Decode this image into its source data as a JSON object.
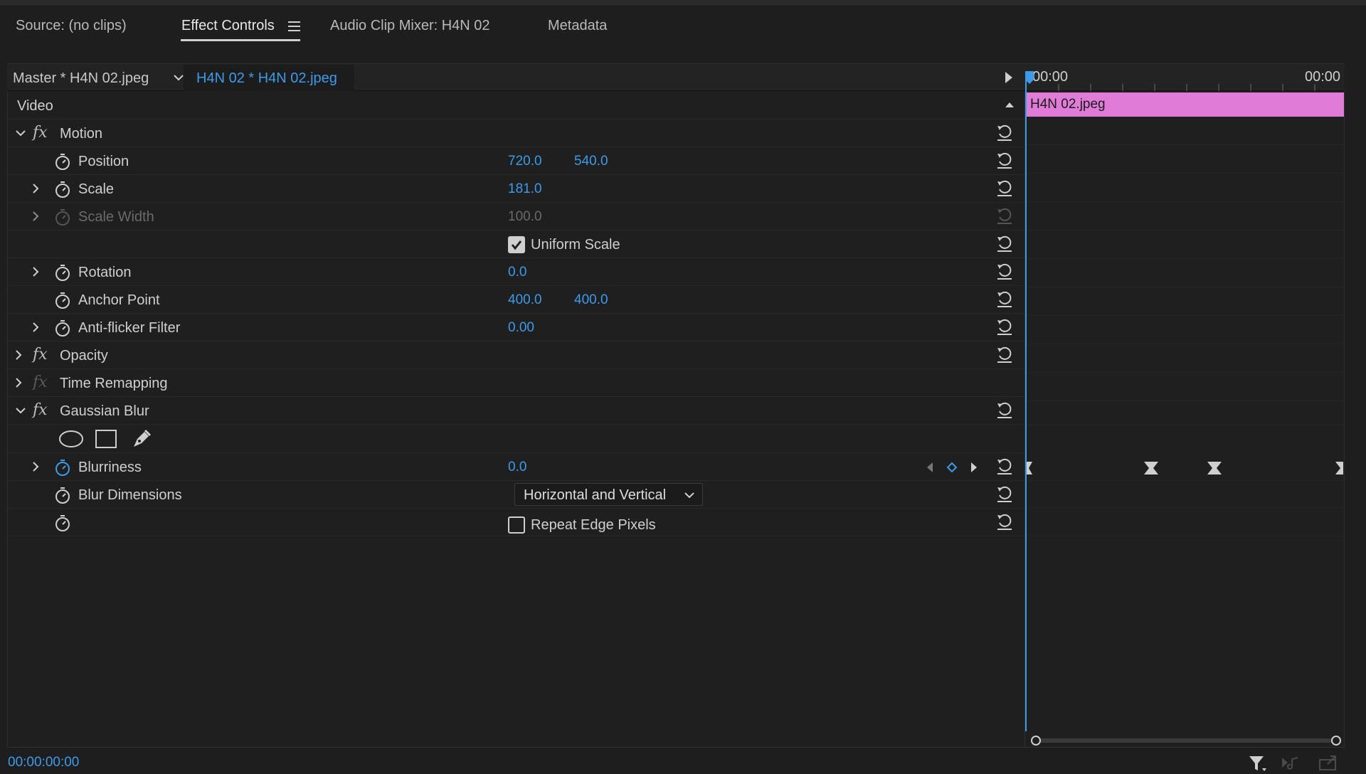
{
  "tabs": [
    {
      "label": "Source: (no clips)"
    },
    {
      "label": "Effect Controls"
    },
    {
      "label": "Audio Clip Mixer: H4N 02"
    },
    {
      "label": "Metadata"
    }
  ],
  "clip_header": {
    "master": "Master * H4N 02.jpeg",
    "sequence_clip": "H4N 02 * H4N 02.jpeg"
  },
  "sections": {
    "video": "Video",
    "motion": "Motion",
    "opacity": "Opacity",
    "time_remapping": "Time Remapping",
    "gaussian_blur": "Gaussian Blur"
  },
  "motion": {
    "position": {
      "label": "Position",
      "x": "720.0",
      "y": "540.0"
    },
    "scale": {
      "label": "Scale",
      "value": "181.0"
    },
    "scale_width": {
      "label": "Scale Width",
      "value": "100.0"
    },
    "uniform_scale": {
      "label": "Uniform Scale",
      "checked": true
    },
    "rotation": {
      "label": "Rotation",
      "value": "0.0"
    },
    "anchor_point": {
      "label": "Anchor Point",
      "x": "400.0",
      "y": "400.0"
    },
    "anti_flicker": {
      "label": "Anti-flicker Filter",
      "value": "0.00"
    }
  },
  "gaussian_blur": {
    "blurriness": {
      "label": "Blurriness",
      "value": "0.0"
    },
    "blur_dimensions": {
      "label": "Blur Dimensions",
      "value": "Horizontal and Vertical"
    },
    "repeat_edge": {
      "label": "Repeat Edge Pixels",
      "checked": false
    }
  },
  "timeline": {
    "start_tc": "00:00",
    "end_tc": "00:00",
    "clip_name": "H4N 02.jpeg"
  },
  "footer": {
    "timecode": "00:00:00:00"
  },
  "colors": {
    "accent_blue": "#3d9be9",
    "clip_pink": "#e07cd8",
    "panel_bg": "#1f1f1f"
  }
}
